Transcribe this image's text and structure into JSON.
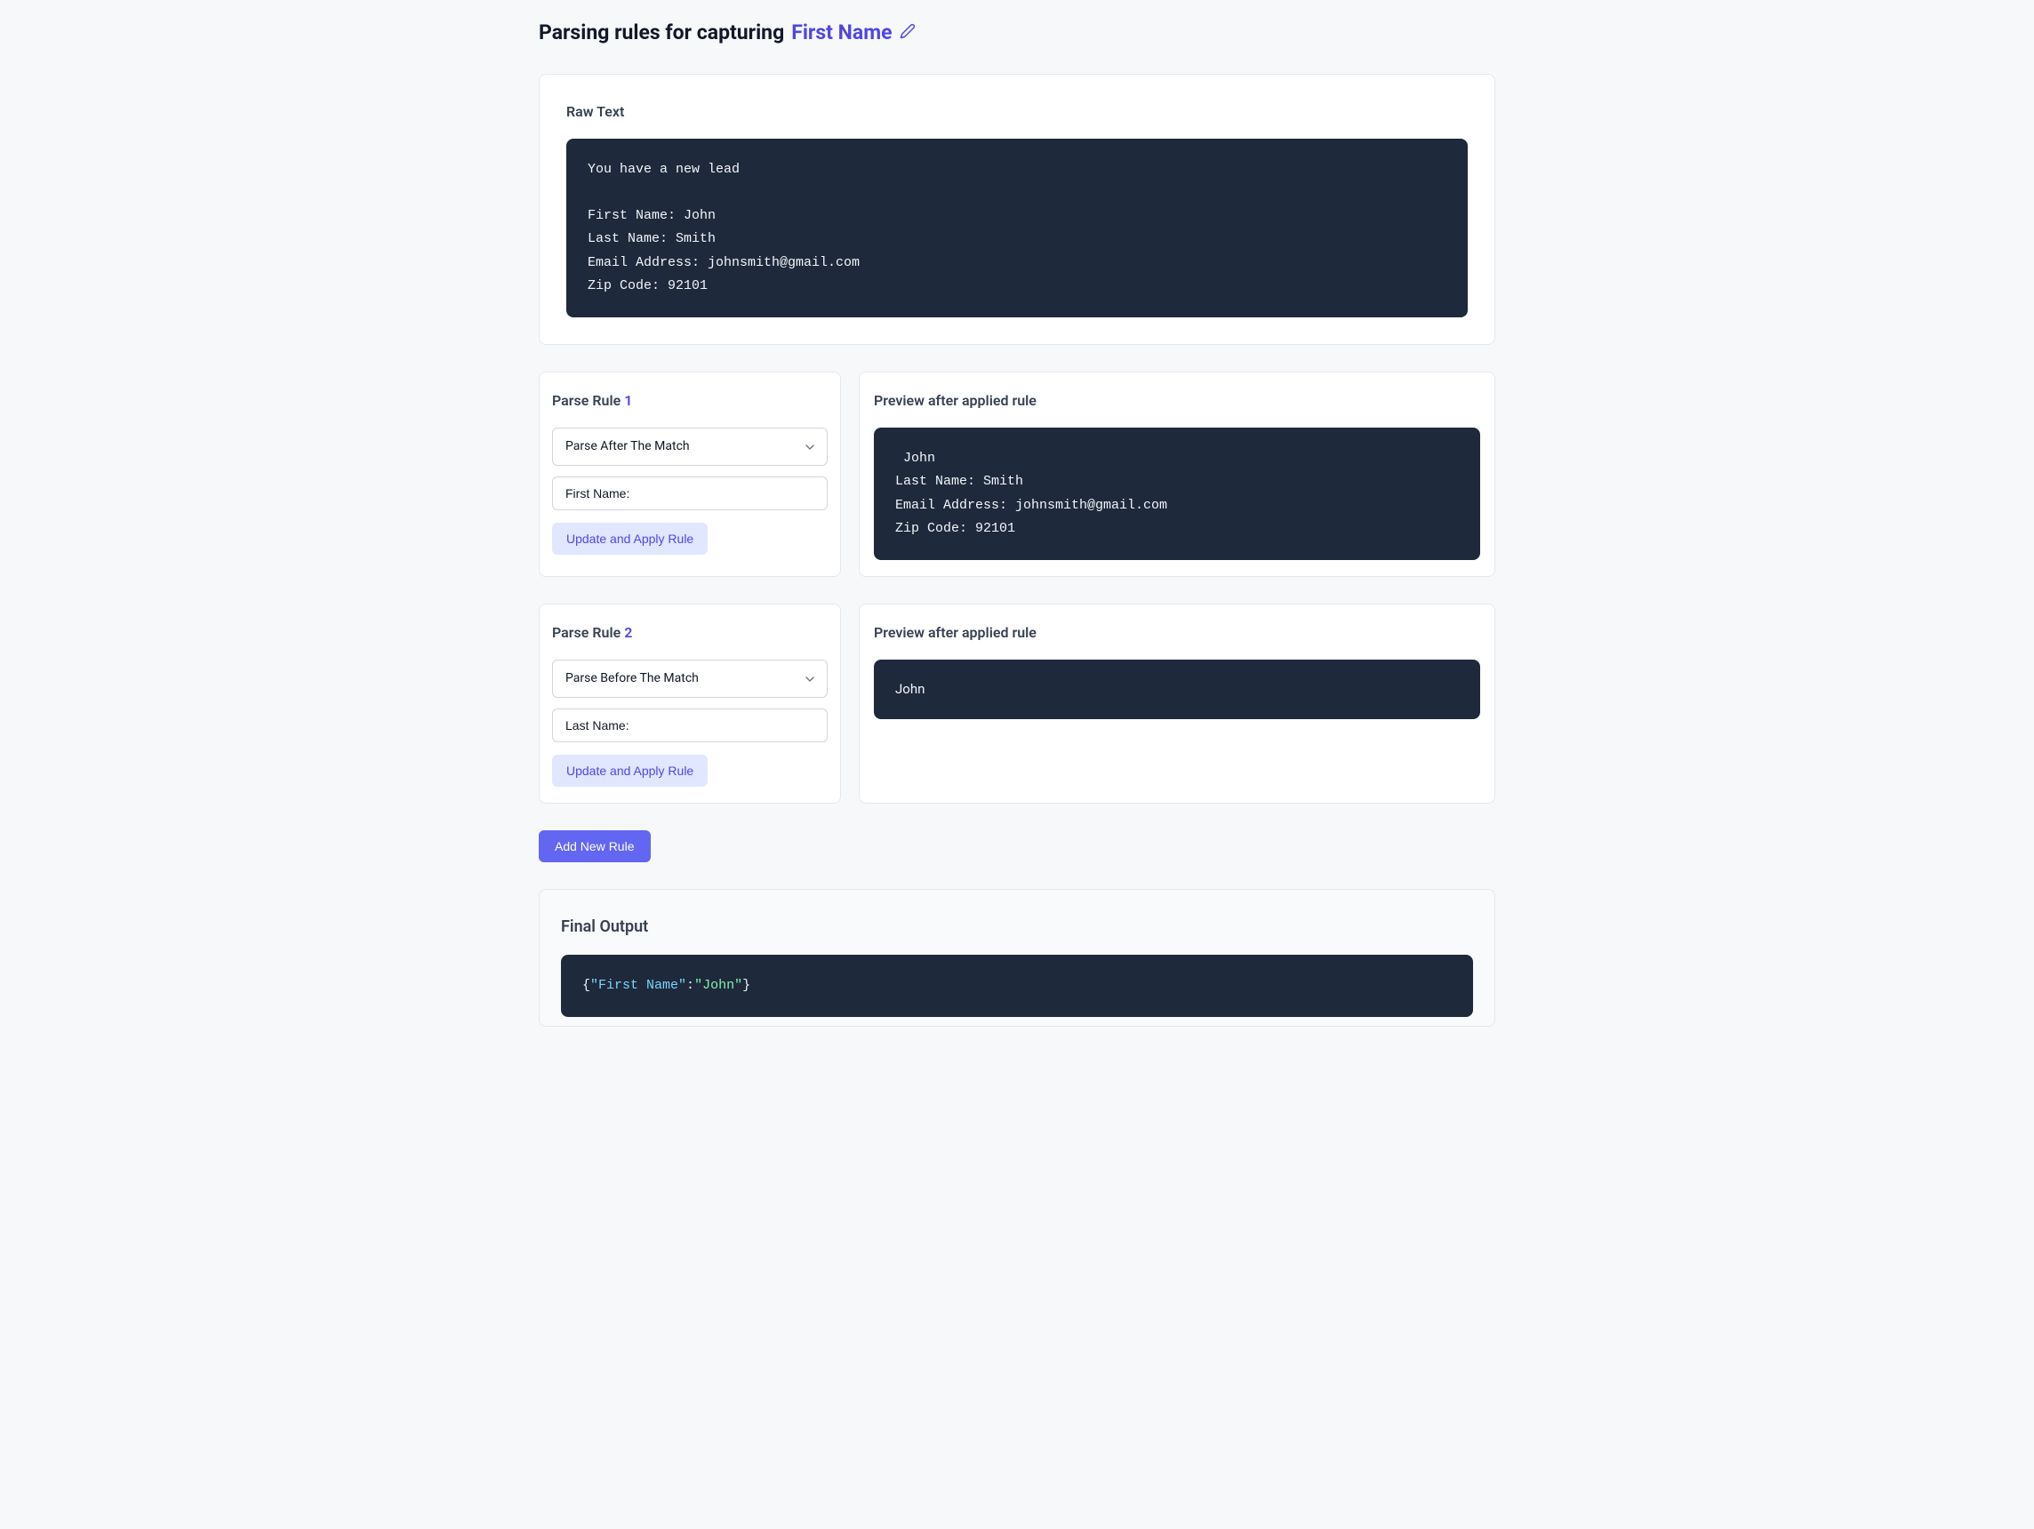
{
  "header": {
    "prefix": "Parsing rules for capturing ",
    "fieldName": "First Name"
  },
  "rawText": {
    "label": "Raw Text",
    "content": "You have a new lead\n\nFirst Name: John\nLast Name: Smith\nEmail Address: johnsmith@gmail.com\nZip Code: 92101"
  },
  "rules": [
    {
      "labelPrefix": "Parse Rule ",
      "number": "1",
      "selectValue": "Parse After The Match",
      "inputValue": "First Name:",
      "updateLabel": "Update and Apply Rule",
      "previewLabel": "Preview after applied rule",
      "previewContent": " John\nLast Name: Smith\nEmail Address: johnsmith@gmail.com\nZip Code: 92101",
      "previewMono": true
    },
    {
      "labelPrefix": "Parse Rule ",
      "number": "2",
      "selectValue": "Parse Before The Match",
      "inputValue": "Last Name:",
      "updateLabel": "Update and Apply Rule",
      "previewLabel": "Preview after applied rule",
      "previewContent": "John",
      "previewMono": false
    }
  ],
  "addRule": {
    "label": "Add New Rule"
  },
  "finalOutput": {
    "label": "Final Output",
    "key": "First Name",
    "value": "John"
  }
}
